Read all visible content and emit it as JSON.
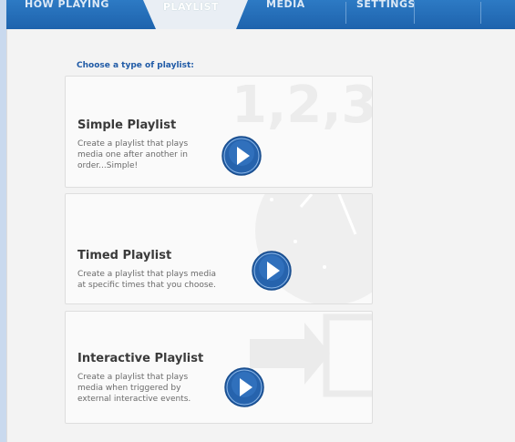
{
  "nav": {
    "tabs": [
      {
        "label": "HOW PLAYING"
      },
      {
        "label": "PLAYLIST"
      },
      {
        "label": "MEDIA"
      },
      {
        "label": "SETTINGS"
      }
    ]
  },
  "main": {
    "heading": "Choose a type of playlist:",
    "cards": [
      {
        "title": "Simple Playlist",
        "description": "Create a playlist that plays\nmedia one after another in\norder...Simple!",
        "bg_text": "1,2,3",
        "icon": "numbers-icon"
      },
      {
        "title": "Timed Playlist",
        "description": "Create a playlist that plays media\nat specific times that you choose.",
        "icon": "clock-icon"
      },
      {
        "title": "Interactive Playlist",
        "description": "Create a playlist that plays\nmedia when triggered by\nexternal interactive events.",
        "icon": "arrow-in-icon"
      }
    ],
    "accent": "#1f5aa6"
  }
}
